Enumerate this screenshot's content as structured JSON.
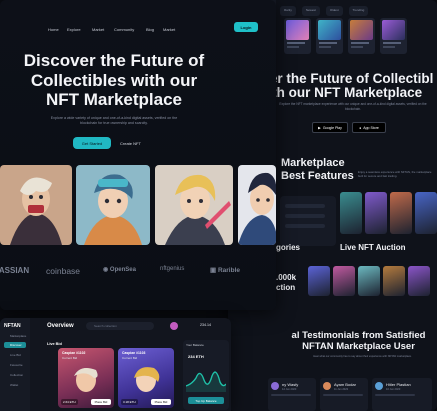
{
  "hero": {
    "nav": [
      "Home",
      "Explore",
      "Market",
      "Community",
      "Blog",
      "Market"
    ],
    "login": "Login",
    "title_lines": [
      "Discover the Future of",
      "Collectibles with our",
      "NFT Marketplace"
    ],
    "subtitle": "Explore a wide variety of unique and one-of-a-kind digital assets, verified on the blockchain for true ownership and scarcity.",
    "primary_button": "Get Started",
    "secondary_button": "Create NFT",
    "logos": [
      "LASSIAN",
      "coinbase",
      "OpenSea",
      "nftgenius",
      "Rarible"
    ]
  },
  "back": {
    "tabs": [
      "Rarity",
      "Newest",
      "Oldest",
      "Trending"
    ],
    "title_lines": [
      "cover the Future of Collectibl",
      "with our NFT Marketplace"
    ],
    "subtitle": "Explore the NFT marketplace experience with our unique and one-of-a-kind digital assets, verified on the blockchain.",
    "store1": "Google Play",
    "store2": "App Store",
    "features_title_lines": [
      "Marketplace",
      "Best Features"
    ],
    "features_text": "Enjoy a seamless experience with NFTAN, the marketplace built for secure and fast trading.",
    "categories": "gories",
    "live_auction": "Live NFT Auction",
    "stats_lines": [
      ".000k",
      "ction"
    ],
    "testimonials_lines": [
      "al Testimonials from Satisfied",
      "NFTAN Marketplace User"
    ],
    "testimonials_sub": "Hear what our community has to say about their experience with NFTAN marketplace.",
    "testimonials": [
      {
        "name": "ny Wasfy",
        "date": "12 Jun 2023"
      },
      {
        "name": "Ayam Bodar",
        "date": "11 Jun 2023"
      },
      {
        "name": "Hitler Plastian",
        "date": "10 Jun 2023"
      }
    ]
  },
  "dashboard": {
    "brand": "NFTAN",
    "menu": [
      "Marketplace",
      "Discover",
      "Live Bid",
      "Favourite",
      "Collection",
      "Wallet"
    ],
    "title": "Overview",
    "search_placeholder": "Search collection",
    "balance": "234.14",
    "live_bid": "Live Bid",
    "cards": [
      {
        "title": "Caspian #1102",
        "price": "Current Bid",
        "eth": "2.64 ETH",
        "bid": "Place Bid"
      },
      {
        "title": "Caspian #1103",
        "price": "Current Bid",
        "eth": "3.18 ETH",
        "bid": "Place Bid"
      }
    ],
    "right_title": "Your Balance",
    "right_eth": "234 ETH",
    "right_cta": "Top Up Balance"
  },
  "colors": {
    "accent": "#20b8c3",
    "background": "#0b0d13"
  }
}
